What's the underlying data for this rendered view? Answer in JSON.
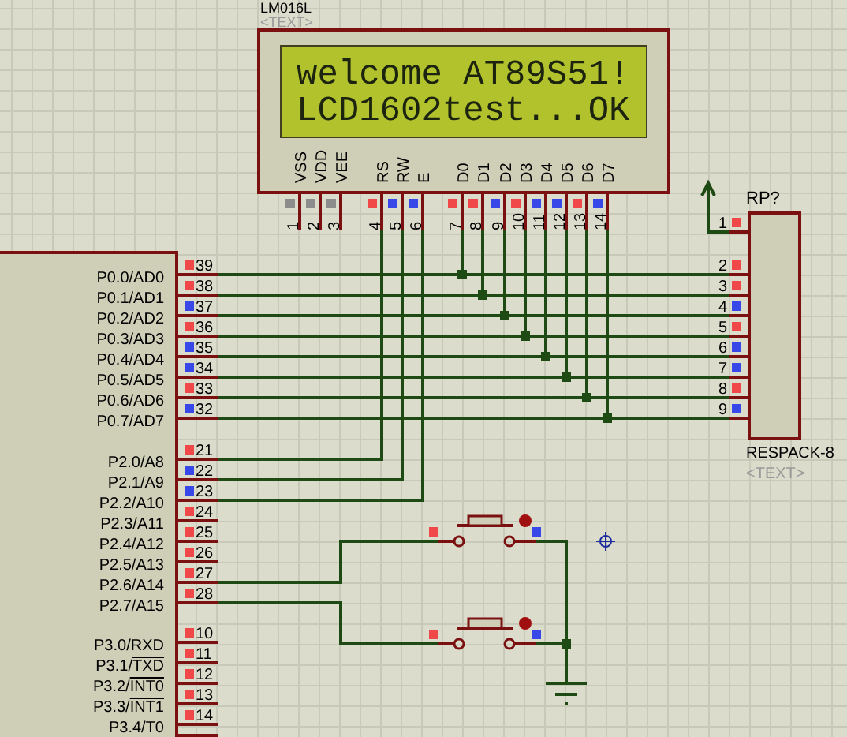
{
  "lcd": {
    "part": "LM016L",
    "ref": "<TEXT>",
    "lines": [
      "welcome AT89S51!",
      "LCD1602test...OK"
    ],
    "pins": [
      {
        "number": "1",
        "label": "VSS",
        "color": "#8c8c8c"
      },
      {
        "number": "2",
        "label": "VDD",
        "color": "#8c8c8c"
      },
      {
        "number": "3",
        "label": "VEE",
        "color": "#8c8c8c"
      },
      {
        "number": "4",
        "label": "RS",
        "color": "#f04848"
      },
      {
        "number": "5",
        "label": "RW",
        "color": "#3848e8"
      },
      {
        "number": "6",
        "label": "E",
        "color": "#3848e8"
      },
      {
        "number": "7",
        "label": "D0",
        "color": "#f04848"
      },
      {
        "number": "8",
        "label": "D1",
        "color": "#f04848"
      },
      {
        "number": "9",
        "label": "D2",
        "color": "#3848e8"
      },
      {
        "number": "10",
        "label": "D3",
        "color": "#f04848"
      },
      {
        "number": "11",
        "label": "D4",
        "color": "#3848e8"
      },
      {
        "number": "12",
        "label": "D5",
        "color": "#3848e8"
      },
      {
        "number": "13",
        "label": "D6",
        "color": "#f04848"
      },
      {
        "number": "14",
        "label": "D7",
        "color": "#3848e8"
      }
    ]
  },
  "mcu": {
    "port0": [
      {
        "label": "P0.0/AD0",
        "number": "39",
        "color": "#f04848"
      },
      {
        "label": "P0.1/AD1",
        "number": "38",
        "color": "#f04848"
      },
      {
        "label": "P0.2/AD2",
        "number": "37",
        "color": "#3848e8"
      },
      {
        "label": "P0.3/AD3",
        "number": "36",
        "color": "#f04848"
      },
      {
        "label": "P0.4/AD4",
        "number": "35",
        "color": "#3848e8"
      },
      {
        "label": "P0.5/AD5",
        "number": "34",
        "color": "#3848e8"
      },
      {
        "label": "P0.6/AD6",
        "number": "33",
        "color": "#f04848"
      },
      {
        "label": "P0.7/AD7",
        "number": "32",
        "color": "#3848e8"
      }
    ],
    "port2": [
      {
        "label": "P2.0/A8",
        "number": "21",
        "color": "#f04848"
      },
      {
        "label": "P2.1/A9",
        "number": "22",
        "color": "#3848e8"
      },
      {
        "label": "P2.2/A10",
        "number": "23",
        "color": "#3848e8"
      },
      {
        "label": "P2.3/A11",
        "number": "24",
        "color": "#f04848"
      },
      {
        "label": "P2.4/A12",
        "number": "25",
        "color": "#f04848"
      },
      {
        "label": "P2.5/A13",
        "number": "26",
        "color": "#f04848"
      },
      {
        "label": "P2.6/A14",
        "number": "27",
        "color": "#f04848"
      },
      {
        "label": "P2.7/A15",
        "number": "28",
        "color": "#f04848"
      }
    ],
    "port3": [
      {
        "label": "P3.0/RXD",
        "number": "10",
        "color": "#f04848",
        "inverted": false
      },
      {
        "label": "P3.1/TXD",
        "number": "11",
        "color": "#f04848",
        "inverted": true
      },
      {
        "label": "P3.2/INT0",
        "number": "12",
        "color": "#f04848",
        "inverted": true
      },
      {
        "label": "P3.3/INT1",
        "number": "13",
        "color": "#f04848",
        "inverted": true
      },
      {
        "label": "P3.4/T0",
        "number": "14",
        "color": "#f04848",
        "inverted": false
      }
    ]
  },
  "respack": {
    "ref": "RP?",
    "part": "RESPACK-8",
    "text": "<TEXT>",
    "pins": [
      {
        "number": "1",
        "color": "#f04848"
      },
      {
        "number": "2",
        "color": "#f04848"
      },
      {
        "number": "3",
        "color": "#f04848"
      },
      {
        "number": "4",
        "color": "#3848e8"
      },
      {
        "number": "5",
        "color": "#f04848"
      },
      {
        "number": "6",
        "color": "#3848e8"
      },
      {
        "number": "7",
        "color": "#3848e8"
      },
      {
        "number": "8",
        "color": "#f04848"
      },
      {
        "number": "9",
        "color": "#3848e8"
      }
    ]
  },
  "buttons": [
    {
      "terminals": [
        {
          "color": "#f04848"
        },
        {
          "color": "#3848e8"
        }
      ]
    },
    {
      "terminals": [
        {
          "color": "#f04848"
        },
        {
          "color": "#3848e8"
        }
      ]
    }
  ]
}
